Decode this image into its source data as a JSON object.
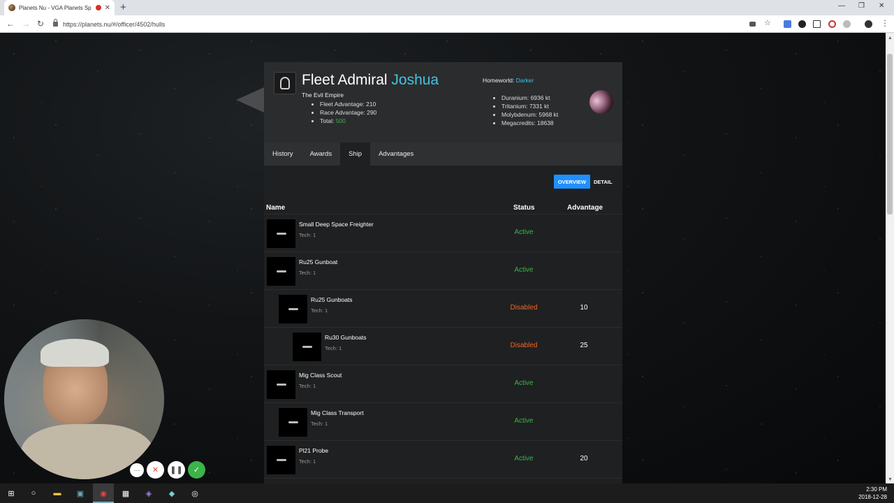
{
  "browser": {
    "tab_title": "Planets Nu - VGA Planets Sp",
    "tab_close": "✕",
    "new_tab": "+",
    "url": "https://planets.nu/#/officer/4502/hulls",
    "window_controls": [
      "—",
      "❐",
      "✕"
    ]
  },
  "officer": {
    "title": "Fleet Admiral",
    "name": "Joshua",
    "race": "The Evil Empire",
    "fleet_advantage": "Fleet Advantage: 210",
    "race_advantage": "Race Advantage: 290",
    "total_label": "Total:",
    "total_value": "500",
    "homeworld_label": "Homeworld:",
    "homeworld_value": "Darker",
    "resources": [
      "Duranium: 6936 kt",
      "Tritanium: 7331 kt",
      "Molybdenum: 5968 kt",
      "Megacredits: 18638"
    ]
  },
  "tabs": [
    "History",
    "Awards",
    "Ship",
    "Advantages"
  ],
  "active_tab": "Ship",
  "view_buttons": {
    "overview": "OVERVIEW",
    "detail": "DETAIL"
  },
  "table": {
    "headers": {
      "name": "Name",
      "status": "Status",
      "advantage": "Advantage"
    },
    "rows": [
      {
        "name": "Small Deep Space Freighter",
        "tech": "Tech: 1",
        "status": "Active",
        "advantage": ""
      },
      {
        "name": "Ru25 Gunboat",
        "tech": "Tech: 1",
        "status": "Active",
        "advantage": ""
      },
      {
        "name": "Ru25 Gunboats",
        "tech": "Tech: 1",
        "status": "Disabled",
        "advantage": "10"
      },
      {
        "name": "Ru30 Gunboats",
        "tech": "Tech: 1",
        "status": "Disabled",
        "advantage": "25"
      },
      {
        "name": "Mig Class Scout",
        "tech": "Tech: 1",
        "status": "Active",
        "advantage": ""
      },
      {
        "name": "Mig Class Transport",
        "tech": "Tech: 1",
        "status": "Active",
        "advantage": ""
      },
      {
        "name": "Pl21 Probe",
        "tech": "Tech: 1",
        "status": "Active",
        "advantage": "20"
      }
    ]
  },
  "recorder": {
    "more": "⋯",
    "cancel": "✕",
    "pause": "❚❚",
    "done": "✓"
  },
  "taskbar": {
    "time": "2:30 PM",
    "date": "2018-12-28"
  },
  "colors": {
    "accent": "#3fc6e4",
    "active": "#39b54a",
    "disabled": "#f26522",
    "button": "#1e90ff"
  }
}
